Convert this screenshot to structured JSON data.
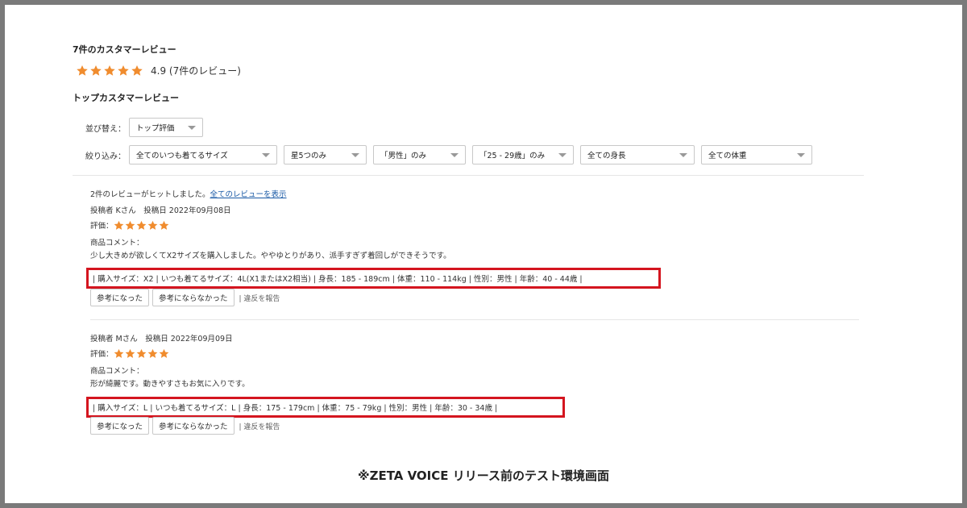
{
  "reviews_header": {
    "title": "7件のカスタマーレビュー",
    "rating_value": 4.9,
    "score_text": "4.9 (7件のレビュー)",
    "top_title": "トップカスタマーレビュー"
  },
  "colors": {
    "star": "#f08c2e",
    "highlight_border": "#d4151f",
    "link": "#1a5aa6"
  },
  "sort": {
    "label": "並び替え：",
    "value": "トップ評価"
  },
  "filter": {
    "label": "絞り込み：",
    "selects": [
      "全てのいつも着てるサイズ",
      "星5つのみ",
      "「男性」のみ",
      "「25 - 29歳」のみ",
      "全ての身長",
      "全ての体重"
    ]
  },
  "hit": {
    "text": "2件のレビューがヒットしました。",
    "link": "全てのレビューを表示"
  },
  "reviews": [
    {
      "meta": "投稿者 Kさん　投稿日 2022年09月08日",
      "rating_label": "評価：",
      "rating": 5,
      "comment_label": "商品コメント：",
      "comment": "少し大きめが欲しくてX2サイズを購入しました。ややゆとりがあり、派手すぎず着回しができそうです。",
      "attrs": "| 購入サイズ：X2 | いつも着てるサイズ：4L(X1またはX2相当) | 身長：185 - 189cm | 体重：110 - 114kg | 性別：男性 | 年齢：40 - 44歳 |",
      "helpful": "参考になった",
      "not_helpful": "参考にならなかった",
      "report": "| 違反を報告"
    },
    {
      "meta": "投稿者 Mさん　投稿日 2022年09月09日",
      "rating_label": "評価：",
      "rating": 5,
      "comment_label": "商品コメント：",
      "comment": "形が綺麗です。動きやすさもお気に入りです。",
      "attrs": "| 購入サイズ：L | いつも着てるサイズ：L | 身長：175 - 179cm | 体重：75 - 79kg | 性別：男性 | 年齢：30 - 34歳 |",
      "helpful": "参考になった",
      "not_helpful": "参考にならなかった",
      "report": "| 違反を報告"
    }
  ],
  "caption": "※ZETA VOICE リリース前のテスト環境画面"
}
